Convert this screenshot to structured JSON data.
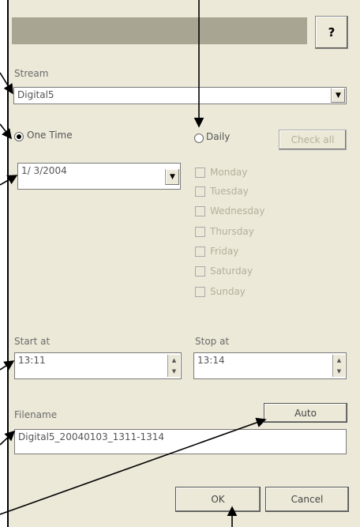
{
  "dialog": {
    "help_label": "?",
    "stream_label": "Stream",
    "stream_value": "Digital5",
    "one_time_label": "One Time",
    "daily_label": "Daily",
    "check_all_label": "Check all",
    "date_value": "1/ 3/2004",
    "days": [
      "Monday",
      "Tuesday",
      "Wednesday",
      "Thursday",
      "Friday",
      "Saturday",
      "Sunday"
    ],
    "start_label": "Start at",
    "start_value": "13:11",
    "stop_label": "Stop at",
    "stop_value": "13:14",
    "filename_label": "Filename",
    "filename_value": "Digital5_20040103_1311-1314",
    "auto_label": "Auto",
    "ok_label": "OK",
    "cancel_label": "Cancel"
  }
}
